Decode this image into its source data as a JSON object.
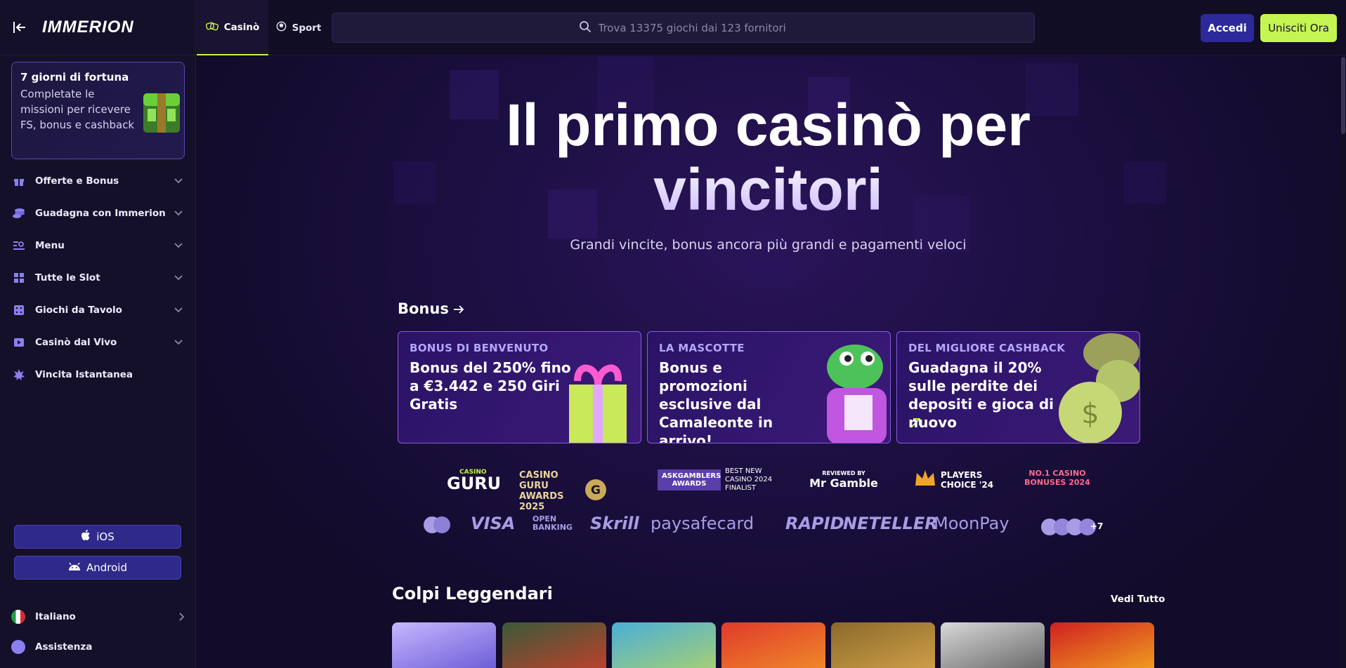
{
  "brand": {
    "logo_text": "IMMERION"
  },
  "sidebar": {
    "promo": {
      "title": "7 giorni di fortuna",
      "description": "Completate le missioni per ricevere FS, bonus e cashback"
    },
    "items": [
      {
        "label": "Offerte e Bonus",
        "icon": "gift-icon",
        "has_chevron": true
      },
      {
        "label": "Guadagna con Immerion",
        "icon": "coins-icon",
        "has_chevron": true
      },
      {
        "label": "Menu",
        "icon": "menu-search-icon",
        "has_chevron": true
      },
      {
        "label": "Tutte le Slot",
        "icon": "grid-icon",
        "has_chevron": true
      },
      {
        "label": "Giochi da Tavolo",
        "icon": "dice-icon",
        "has_chevron": true
      },
      {
        "label": "Casinò dal Vivo",
        "icon": "play-icon",
        "has_chevron": true
      },
      {
        "label": "Vincita Istantanea",
        "icon": "burst-icon",
        "has_chevron": false
      }
    ],
    "apps": {
      "ios": "iOS",
      "android": "Android"
    },
    "language": "Italiano",
    "support": "Assistenza"
  },
  "topbar": {
    "tabs": [
      {
        "label": "Casinò",
        "active": true
      },
      {
        "label": "Sport",
        "active": false
      }
    ],
    "search_placeholder": "Trova 13375 giochi dai 123 fornitori",
    "login": "Accedi",
    "join": "Unisciti Ora"
  },
  "hero": {
    "title_line1": "Il primo casinò per",
    "title_line2": "vincitori",
    "subtitle": "Grandi vincite, bonus ancora più grandi e pagamenti veloci"
  },
  "bonus_section": {
    "title": "Bonus",
    "cards": [
      {
        "tag": "BONUS DI BENVENUTO",
        "text": "Bonus del 250% fino a €3.442 e 250 Giri Gratis"
      },
      {
        "tag": "LA MASCOTTE",
        "text": "Bonus e promozioni esclusive dal Camaleonte in arrivo!"
      },
      {
        "tag": "DEL MIGLIORE CASHBACK",
        "text": "Guadagna il 20% sulle perdite dei depositi e gioca di nuovo"
      }
    ]
  },
  "awards": {
    "casino_guru": "GURU",
    "casino_guru_small": "CASINO",
    "guru_awards": "CASINO GURU AWARDS 2025",
    "askgamblers": "ASKGAMBLERS AWARDS",
    "askgamblers_note": "BEST NEW CASINO 2024 FINALIST",
    "mrgamble": "Mr Gamble",
    "mrgamble_small": "REVIEWED BY",
    "players_choice": "PLAYERS CHOICE '24",
    "no1": "NO.1 CASINO BONUSES 2024"
  },
  "payments": [
    "VISA",
    "OPEN BANKING",
    "Skrill",
    "paysafecard",
    "RAPID",
    "NETELLER",
    "MoonPay",
    "+7"
  ],
  "games_section": {
    "title": "Colpi Leggendari",
    "see_all": "Vedi Tutto"
  },
  "colors": {
    "accent_green": "#c5f551",
    "accent_blue": "#2c2a9a",
    "card_border": "#8a5ae0"
  }
}
